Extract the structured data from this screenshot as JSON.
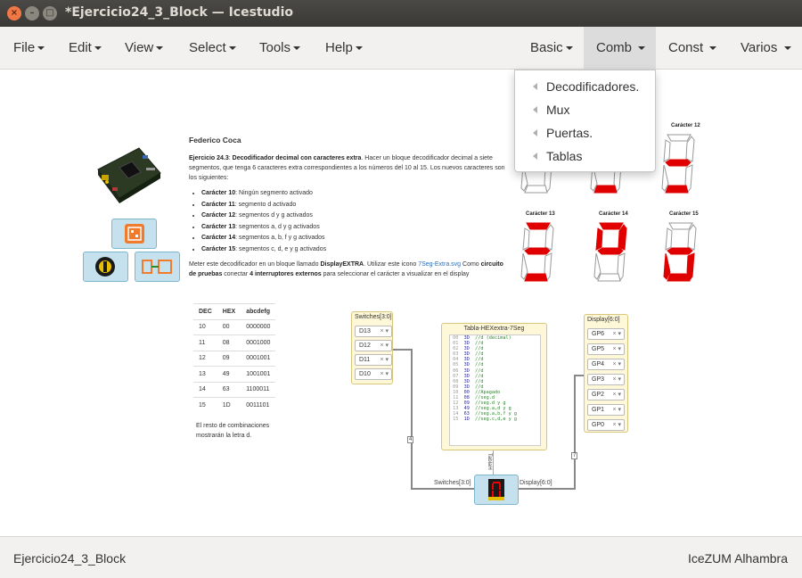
{
  "window": {
    "title": "*Ejercicio24_3_Block — Icestudio",
    "close_glyph": "×",
    "min_glyph": "–",
    "max_glyph": "□"
  },
  "menubar": {
    "left": [
      "File",
      "Edit",
      "View",
      "Select",
      "Tools",
      "Help"
    ],
    "right": [
      "Basic",
      "Comb",
      "Const",
      "Varios"
    ]
  },
  "comb_dropdown": [
    "Decodificadores.",
    "Mux",
    "Puertas.",
    "Tablas"
  ],
  "doc": {
    "author": "Federico Coca",
    "intro_label": "Ejercicio 24.3",
    "intro_title": "Decodificador decimal con caracteres extra",
    "intro_text": "Hacer un bloque decodificador decimal a siete segmentos, que tenga 6 caracteres extra correspondientes a los números del 10 al 15. Los nuevos caracteres son los siguientes:",
    "items": [
      {
        "label": "Carácter 10",
        "text": ": Ningún segmento activado"
      },
      {
        "label": "Carácter 11",
        "text": ": segmento d activado"
      },
      {
        "label": "Carácter 12",
        "text": ": segmentos d y g activados"
      },
      {
        "label": "Carácter 13",
        "text": ": segmentos a, d y g activados"
      },
      {
        "label": "Carácter 14",
        "text": ": segmentos a, b, f y g activados"
      },
      {
        "label": "Carácter 15",
        "text": ": segmentos c, d, e y g activados"
      }
    ],
    "footer_pre": "Meter este decodificador en un bloque llamado ",
    "footer_bold": "DisplayEXTRA",
    "footer_mid": ". Utilizar este icono ",
    "footer_link": "7Seg-Extra.svg",
    "footer_mid2": " Como ",
    "footer_bold2": "circuito de pruebas",
    "footer_mid3": " conectar ",
    "footer_bold3": "4 interruptores externos",
    "footer_post": " para seleccionar el carácter a visualizar en el display"
  },
  "char_labels": [
    "Carácter 12",
    "Carácter 13",
    "Carácter 14",
    "Carácter 15"
  ],
  "displays": [
    {
      "segs": [
        0,
        0,
        0,
        0,
        0,
        0,
        0
      ]
    },
    {
      "segs": [
        0,
        0,
        0,
        1,
        0,
        0,
        0
      ]
    },
    {
      "segs": [
        0,
        0,
        0,
        1,
        0,
        0,
        1
      ]
    },
    {
      "segs": [
        1,
        0,
        0,
        1,
        0,
        0,
        1
      ]
    },
    {
      "segs": [
        1,
        1,
        0,
        0,
        0,
        1,
        1
      ]
    },
    {
      "segs": [
        0,
        0,
        1,
        1,
        1,
        0,
        1
      ]
    }
  ],
  "seg_color": "#e00000",
  "table": {
    "headers": [
      "DEC",
      "HEX",
      "abcdefg"
    ],
    "rows": [
      [
        "10",
        "00",
        "0000000"
      ],
      [
        "11",
        "08",
        "0001000"
      ],
      [
        "12",
        "09",
        "0001001"
      ],
      [
        "13",
        "49",
        "1001001"
      ],
      [
        "14",
        "63",
        "1100011"
      ],
      [
        "15",
        "1D",
        "0011101"
      ]
    ],
    "note": "El resto de combinaciones mostrarán la letra d."
  },
  "switches": {
    "title": "Switches[3:0]",
    "pins": [
      "D13",
      "D12",
      "D11",
      "D10"
    ]
  },
  "code_block": {
    "title": "Tabla-HEXextra-7Seg",
    "lines": [
      [
        "00",
        "3D",
        "//d (decimal)"
      ],
      [
        "01",
        "3D",
        "//d"
      ],
      [
        "02",
        "3D",
        "//d"
      ],
      [
        "03",
        "3D",
        "//d"
      ],
      [
        "04",
        "3D",
        "//d"
      ],
      [
        "05",
        "3D",
        "//d"
      ],
      [
        "06",
        "3D",
        "//d"
      ],
      [
        "07",
        "3D",
        "//d"
      ],
      [
        "08",
        "3D",
        "//d"
      ],
      [
        "09",
        "3D",
        "//d"
      ],
      [
        "10",
        "00",
        "//Apagado"
      ],
      [
        "11",
        "08",
        "//seg.d"
      ],
      [
        "12",
        "09",
        "//seg.d y g"
      ],
      [
        "13",
        "49",
        "//seg.a,d y g"
      ],
      [
        "14",
        "63",
        "//seg.a,b,f y g"
      ],
      [
        "15",
        "1D",
        "//seg.c,d,e y g"
      ]
    ]
  },
  "display_out": {
    "title": "Display[6:0]",
    "pins": [
      "GP6",
      "GP5",
      "GP4",
      "GP3",
      "GP2",
      "GP1",
      "GP0"
    ]
  },
  "wires": {
    "in_label": "Switches[3:0]",
    "out_label": "Display[6:0]",
    "tabla_label": "TablaH",
    "bus4": "4",
    "bus7": "7"
  },
  "status": {
    "left": "Ejercicio24_3_Block",
    "right": "IceZUM Alhambra"
  }
}
